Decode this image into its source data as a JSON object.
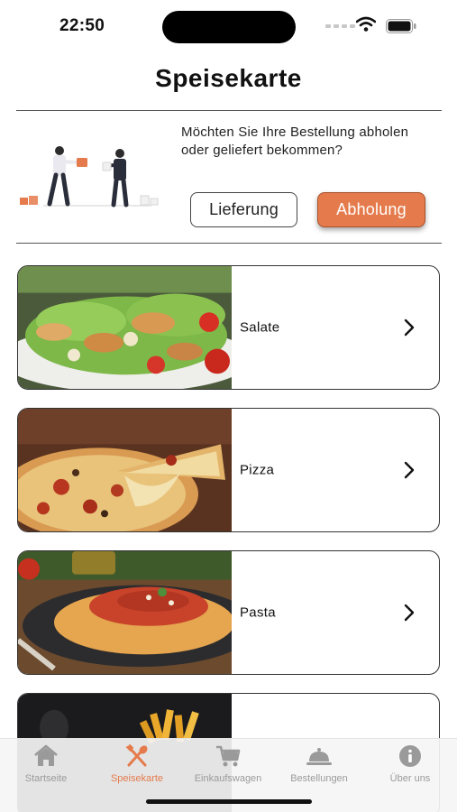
{
  "status_bar": {
    "time": "22:50"
  },
  "header": {
    "title": "Speisekarte"
  },
  "delivery_panel": {
    "question": "Möchten Sie Ihre Bestellung abholen oder geliefert bekommen?",
    "delivery_label": "Lieferung",
    "pickup_label": "Abholung",
    "selected": "Abholung",
    "accent_color": "#e57b4c"
  },
  "categories": [
    {
      "label": "Salate",
      "image": "salad-photo"
    },
    {
      "label": "Pizza",
      "image": "pizza-photo"
    },
    {
      "label": "Pasta",
      "image": "pasta-photo"
    },
    {
      "label": "",
      "image": "fries-photo"
    }
  ],
  "tab_bar": {
    "tabs": [
      {
        "label": "Startseite",
        "icon": "home-icon",
        "active": false
      },
      {
        "label": "Speisekarte",
        "icon": "utensils-icon",
        "active": true
      },
      {
        "label": "Einkaufswagen",
        "icon": "cart-icon",
        "active": false
      },
      {
        "label": "Bestellungen",
        "icon": "cloche-icon",
        "active": false
      },
      {
        "label": "Über uns",
        "icon": "info-icon",
        "active": false
      }
    ]
  }
}
